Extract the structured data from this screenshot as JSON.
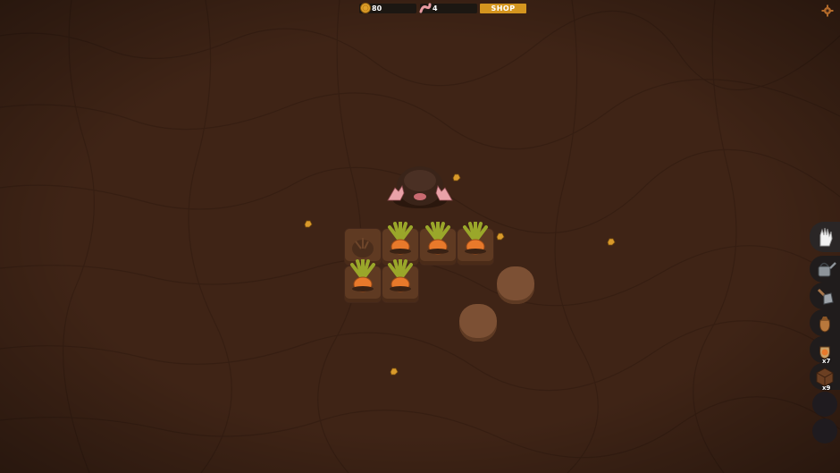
{
  "hud": {
    "coins": "80",
    "worms": "4",
    "shop_label": "SHOP",
    "coin_icon": "coin-icon",
    "worm_icon": "worm-icon",
    "settings_icon": "gear-icon"
  },
  "garden": {
    "planted_tiles": 5,
    "empty_dug_tiles": 1,
    "crop": "carrot"
  },
  "toolbar": {
    "slots": [
      {
        "icon": "glove-icon",
        "count": ""
      },
      {
        "icon": "watering-can-icon",
        "count": ""
      },
      {
        "icon": "shovel-icon",
        "count": ""
      },
      {
        "icon": "seed-bag-icon",
        "count": ""
      },
      {
        "icon": "carrot-seed-bag-icon",
        "count": "x7"
      },
      {
        "icon": "dirt-block-icon",
        "count": "x9"
      }
    ],
    "empty_slots": 2
  },
  "colors": {
    "ground": "#3d2315",
    "shop": "#d4951f",
    "hud_bg": "#1c1712",
    "carrot": "#e8792b",
    "leaf": "#9aa72a"
  }
}
